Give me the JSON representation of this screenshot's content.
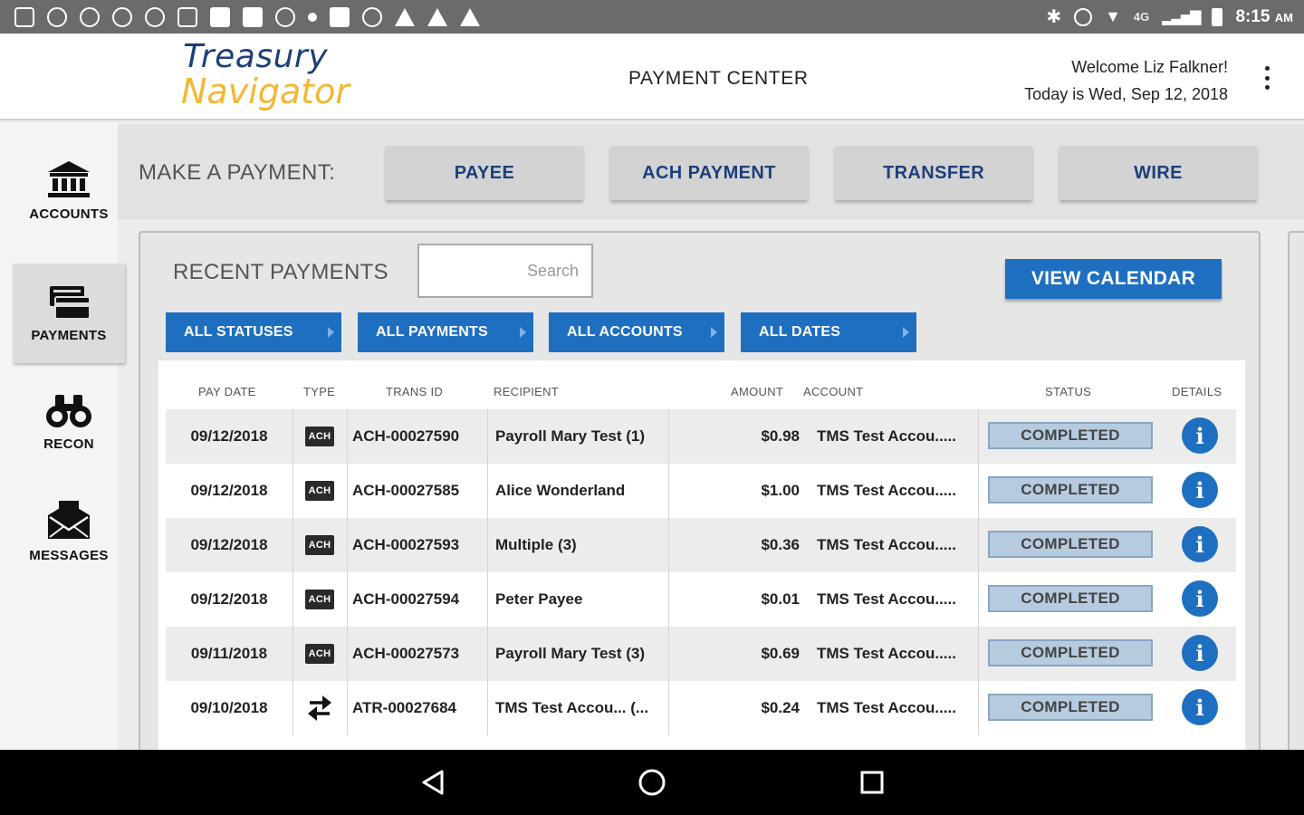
{
  "status_bar": {
    "time": "8:15",
    "ampm": "AM",
    "network": "4G"
  },
  "header": {
    "logo_line1": "Treasury",
    "logo_line2": "Navigator",
    "page_title": "PAYMENT CENTER",
    "welcome": "Welcome Liz Falkner!",
    "today": "Today is Wed, Sep 12, 2018"
  },
  "sidebar": {
    "items": [
      {
        "label": "ACCOUNTS",
        "icon": "bank-icon"
      },
      {
        "label": "PAYMENTS",
        "icon": "payments-icon",
        "active": true
      },
      {
        "label": "RECON",
        "icon": "binoculars-icon"
      },
      {
        "label": "MESSAGES",
        "icon": "envelope-icon"
      }
    ]
  },
  "make_payment": {
    "label": "MAKE A PAYMENT:",
    "buttons": [
      "PAYEE",
      "ACH PAYMENT",
      "TRANSFER",
      "WIRE"
    ]
  },
  "recent": {
    "title": "RECENT PAYMENTS",
    "search_placeholder": "Search",
    "calendar_button": "VIEW CALENDAR",
    "filters": [
      "ALL STATUSES",
      "ALL PAYMENTS",
      "ALL ACCOUNTS",
      "ALL DATES"
    ]
  },
  "table": {
    "columns": [
      "PAY DATE",
      "TYPE",
      "TRANS ID",
      "RECIPIENT",
      "AMOUNT",
      "ACCOUNT",
      "STATUS",
      "DETAILS"
    ],
    "ach_label": "ACH",
    "rows": [
      {
        "date": "09/12/2018",
        "type": "ach",
        "trans_id": "ACH-00027590",
        "recipient": "Payroll Mary Test (1)",
        "amount": "$0.98",
        "account": "TMS Test Accou.....",
        "status": "COMPLETED",
        "details": "i"
      },
      {
        "date": "09/12/2018",
        "type": "ach",
        "trans_id": "ACH-00027585",
        "recipient": "Alice Wonderland",
        "amount": "$1.00",
        "account": "TMS Test Accou.....",
        "status": "COMPLETED",
        "details": "i"
      },
      {
        "date": "09/12/2018",
        "type": "ach",
        "trans_id": "ACH-00027593",
        "recipient": "Multiple (3)",
        "amount": "$0.36",
        "account": "TMS Test Accou.....",
        "status": "COMPLETED",
        "details": "i"
      },
      {
        "date": "09/12/2018",
        "type": "ach",
        "trans_id": "ACH-00027594",
        "recipient": "Peter Payee",
        "amount": "$0.01",
        "account": "TMS Test Accou.....",
        "status": "COMPLETED",
        "details": "i"
      },
      {
        "date": "09/11/2018",
        "type": "ach",
        "trans_id": "ACH-00027573",
        "recipient": "Payroll Mary Test (3)",
        "amount": "$0.69",
        "account": "TMS Test Accou.....",
        "status": "COMPLETED",
        "details": "i"
      },
      {
        "date": "09/10/2018",
        "type": "transfer",
        "trans_id": "ATR-00027684",
        "recipient": "TMS Test Accou... (...",
        "amount": "$0.24",
        "account": "TMS Test Accou.....",
        "status": "COMPLETED",
        "details": "i"
      }
    ]
  },
  "colors": {
    "brand_blue": "#1f6fc0",
    "logo_navy": "#1c3f7a",
    "logo_gold": "#f3b731",
    "status_completed_bg": "#b7cbe0"
  }
}
